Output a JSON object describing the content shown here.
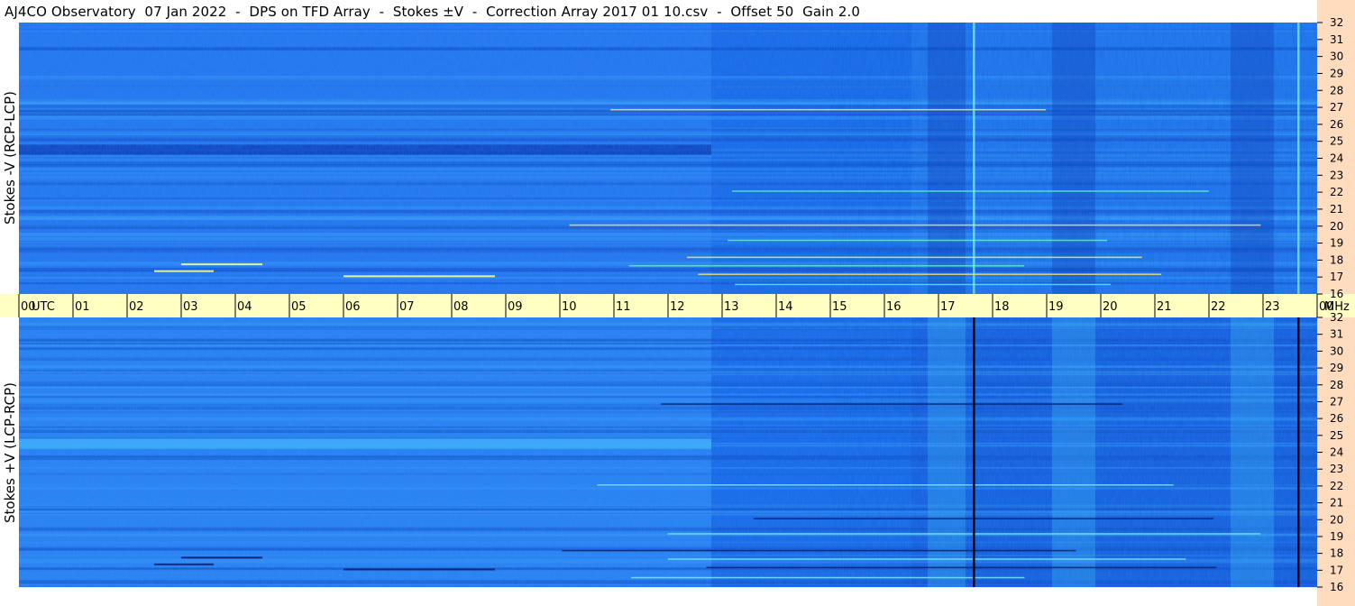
{
  "title": "AJ4CO Observatory  07 Jan 2022  -  DPS on TFD Array  -  Stokes ±V  -  Correction Array 2017 01 10.csv  -  Offset 50  Gain 2.0",
  "panels": [
    {
      "label": "Stokes -V (RCP-LCP)"
    },
    {
      "label": "Stokes +V (LCP-RCP)"
    }
  ],
  "colors": {
    "timebar": "#ffffc4",
    "freqbar": "#ffdcbe",
    "base_blue": "#1c6ce8"
  },
  "chart_data": {
    "type": "heatmap",
    "title": "AJ4CO Observatory  07 Jan 2022  -  DPS on TFD Array  -  Stokes ±V  -  Correction Array 2017 01 10.csv  -  Offset 50  Gain 2.0",
    "x_label": "UTC",
    "x_range": [
      0,
      24
    ],
    "x_ticks": [
      "00",
      "01",
      "02",
      "03",
      "04",
      "05",
      "06",
      "07",
      "08",
      "09",
      "10",
      "11",
      "12",
      "13",
      "14",
      "15",
      "16",
      "17",
      "18",
      "19",
      "20",
      "21",
      "22",
      "23",
      "00"
    ],
    "y_unit": "MHz",
    "y_range": [
      16,
      32
    ],
    "y_ticks": [
      "16",
      "17",
      "18",
      "19",
      "20",
      "21",
      "22",
      "23",
      "24",
      "25",
      "26",
      "27",
      "28",
      "29",
      "30",
      "31",
      "32"
    ],
    "panels": [
      "Stokes -V (RCP-LCP)",
      "Stokes +V (LCP-RCP)"
    ],
    "features": {
      "dark_vertical_lines_utc": [
        17.65,
        23.65
      ],
      "bright_vertical_lines_utc_top": [
        17.65,
        23.65
      ],
      "dark_band_top_mhz": [
        24.3,
        24.7
      ],
      "bright_band_bottom_mhz": [
        24.3,
        24.7
      ],
      "rfi_lines_mhz": [
        16.6,
        17.2,
        17.7,
        18.2,
        19.2,
        20.1,
        22.1,
        26.9
      ]
    }
  }
}
